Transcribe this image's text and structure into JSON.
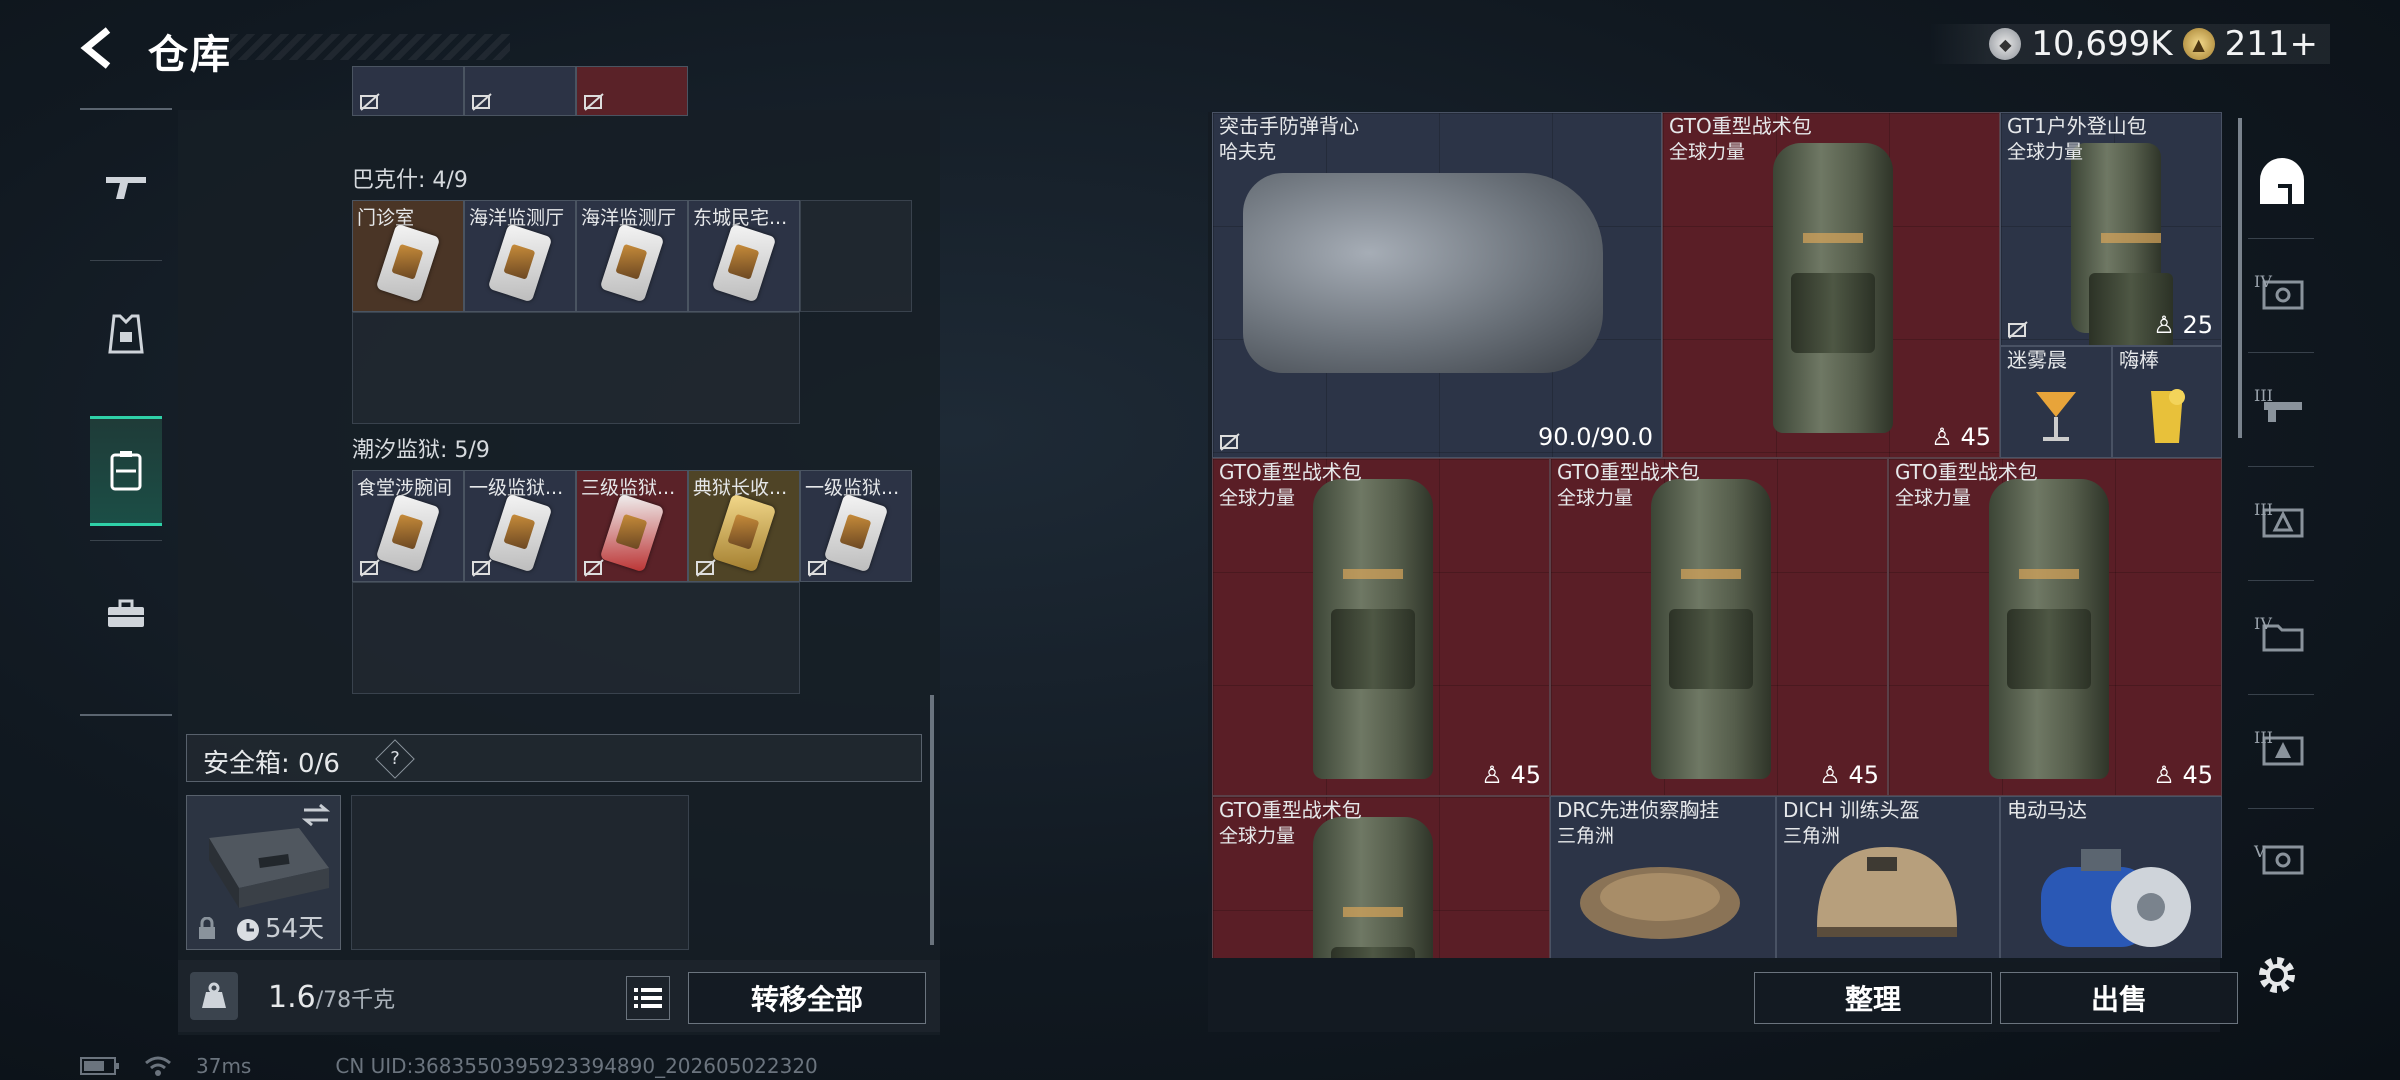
{
  "header": {
    "title": "仓库",
    "currency_silver": "10,699K",
    "currency_gold": "211+"
  },
  "left_nav": [
    "weapon-icon",
    "armor-icon",
    "storage-icon",
    "toolbox-icon"
  ],
  "groups": [
    {
      "title": "巴克什: 4/9",
      "items": [
        "门诊室",
        "海洋监测厅",
        "海洋监测厅",
        "东城民宅..."
      ]
    },
    {
      "title": "潮汐监狱: 5/9",
      "items": [
        "食堂涉腕间",
        "一级监狱...",
        "三级监狱...",
        "典狱长收...",
        "一级监狱..."
      ]
    }
  ],
  "safe": {
    "label": "安全箱: 0/6",
    "help": "?",
    "timer": "54天"
  },
  "footer_left": {
    "weight_current": "1.6",
    "weight_max": "/78千克",
    "transfer_all": "转移全部"
  },
  "right_items": [
    {
      "name": "突击手防弹背心",
      "sub": "哈夫克",
      "qty": "90.0/90.0"
    },
    {
      "name": "GTO重型战术包",
      "sub": "全球力量",
      "qty": "45"
    },
    {
      "name": "GT1户外登山包",
      "sub": "全球力量",
      "qty": "25"
    },
    {
      "name": "迷雾晨",
      "sub": "",
      "qty": ""
    },
    {
      "name": "嗨棒",
      "sub": "",
      "qty": ""
    },
    {
      "name": "GTO重型战术包",
      "sub": "全球力量",
      "qty": "45"
    },
    {
      "name": "GTO重型战术包",
      "sub": "全球力量",
      "qty": "45"
    },
    {
      "name": "GTO重型战术包",
      "sub": "全球力量",
      "qty": "45"
    },
    {
      "name": "GTO重型战术包",
      "sub": "全球力量",
      "qty": ""
    },
    {
      "name": "DRC先进侦察胸挂",
      "sub": "三角洲",
      "qty": ""
    },
    {
      "name": "DICH 训练头盔",
      "sub": "三角洲",
      "qty": ""
    },
    {
      "name": "电动马达",
      "sub": "",
      "qty": ""
    }
  ],
  "right_nav_levels": [
    "IV",
    "III",
    "III",
    "IV",
    "III",
    "V"
  ],
  "footer_right": {
    "sort": "整理",
    "sell": "出售"
  },
  "status": {
    "ping": "37ms",
    "uid": "CN UID:3683550395923394890_202605022320"
  }
}
